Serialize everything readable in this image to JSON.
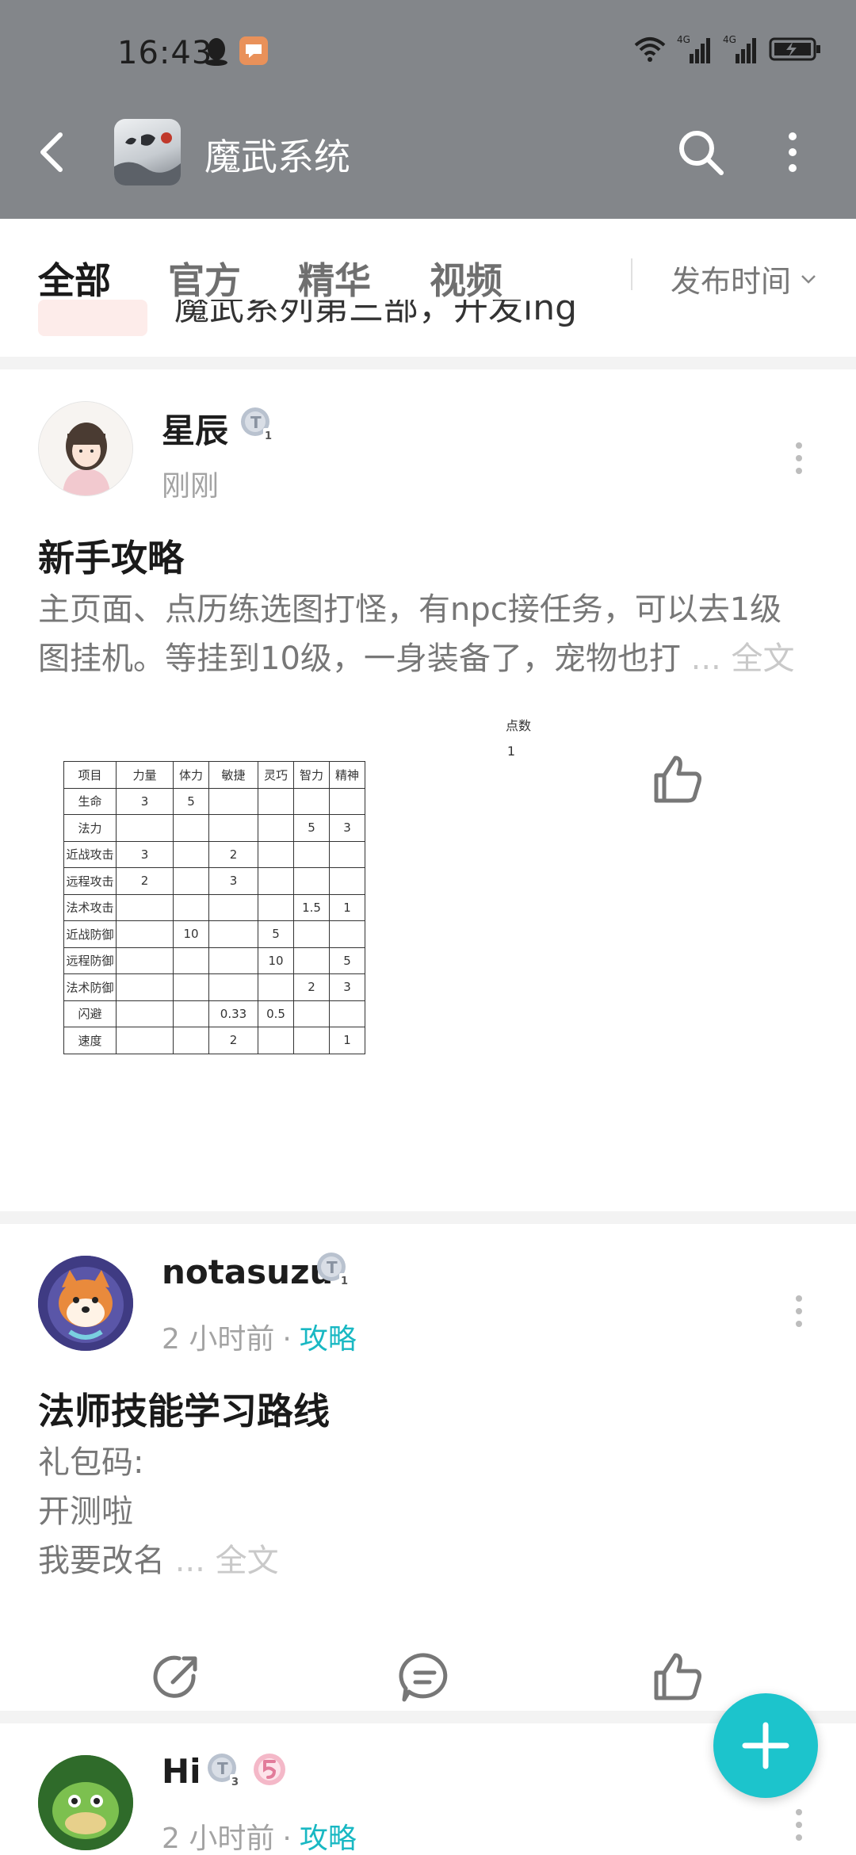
{
  "status_bar": {
    "time": "16:43",
    "network_1": "4G",
    "network_2": "4G"
  },
  "header": {
    "title": "魔武系统"
  },
  "tabs": [
    {
      "label": "全部",
      "active": true
    },
    {
      "label": "官方",
      "active": false
    },
    {
      "label": "精华",
      "active": false
    },
    {
      "label": "视频",
      "active": false
    }
  ],
  "sort": {
    "label": "发布时间"
  },
  "partial_post": {
    "text": "魔武系列第三部，开发ing"
  },
  "posts": [
    {
      "author": "星辰",
      "level": "1",
      "time": "刚刚",
      "tag": "",
      "title": "新手攻略",
      "body_lines": [
        "主页面、点历练选图打怪，有npc接任务，可以去1级",
        "图挂机。等挂到10级，一身装备了，宠物也打"
      ],
      "more": "... 全文"
    },
    {
      "author": "notasuzu",
      "level": "1",
      "time": "2 小时前",
      "tag": "攻略",
      "title": "法师技能学习路线",
      "body_lines": [
        "礼包码:",
        "开测啦",
        "我要改名"
      ],
      "more": "... 全文"
    },
    {
      "author": "Hi",
      "level": "3",
      "time": "2 小时前",
      "tag": "攻略"
    }
  ],
  "stat_table": {
    "points_label": "点数",
    "points_value": "1",
    "headers": [
      "项目",
      "力量",
      "体力",
      "敏捷",
      "灵巧",
      "智力",
      "精神"
    ],
    "rows": [
      [
        "生命",
        "3",
        "5",
        "",
        "",
        "",
        ""
      ],
      [
        "法力",
        "",
        "",
        "",
        "",
        "5",
        "3"
      ],
      [
        "近战攻击",
        "3",
        "",
        "2",
        "",
        "",
        ""
      ],
      [
        "远程攻击",
        "2",
        "",
        "3",
        "",
        "",
        ""
      ],
      [
        "法术攻击",
        "",
        "",
        "",
        "",
        "1.5",
        "1"
      ],
      [
        "近战防御",
        "",
        "10",
        "",
        "5",
        "",
        ""
      ],
      [
        "远程防御",
        "",
        "",
        "",
        "10",
        "",
        "5"
      ],
      [
        "法术防御",
        "",
        "",
        "",
        "",
        "2",
        "3"
      ],
      [
        "闪避",
        "",
        "",
        "0.33",
        "0.5",
        "",
        ""
      ],
      [
        "速度",
        "",
        "",
        "2",
        "",
        "",
        "1"
      ]
    ]
  },
  "colors": {
    "header_bg": "#83868a",
    "accent": "#1cc4cc",
    "tag": "#19b8c3"
  }
}
